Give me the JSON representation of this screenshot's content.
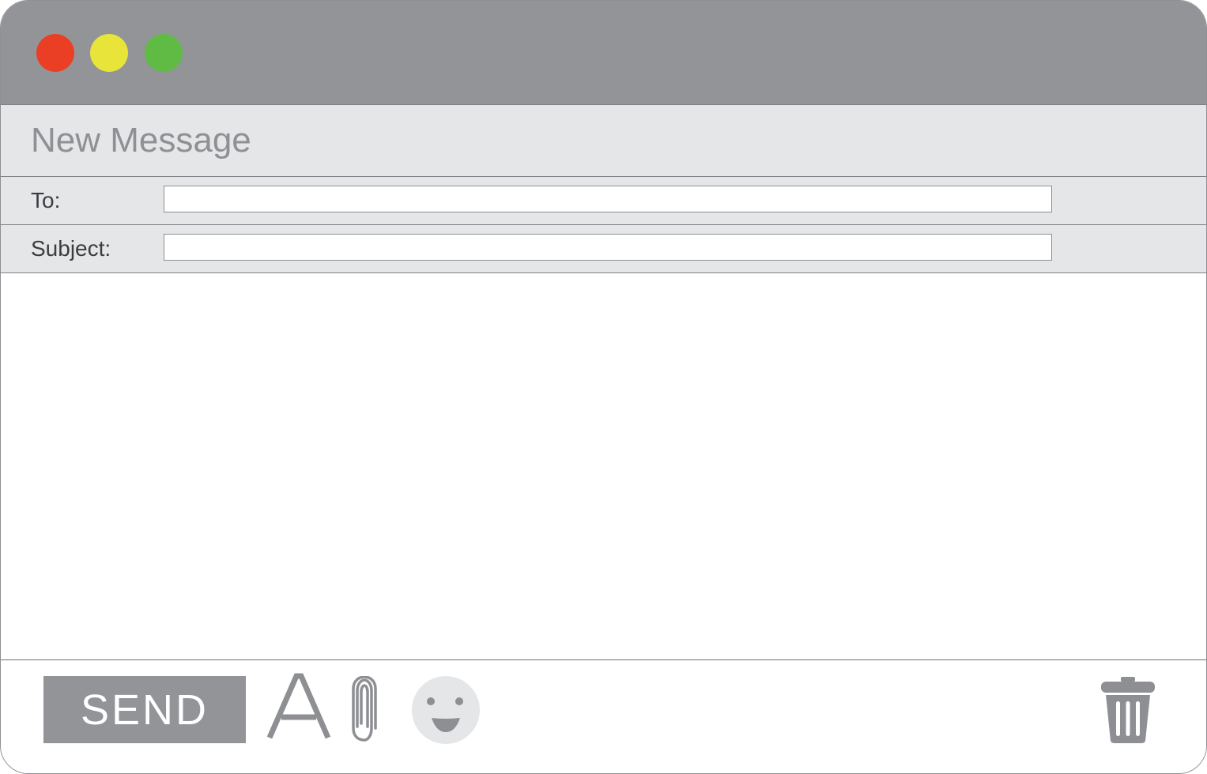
{
  "window": {
    "controls": [
      {
        "name": "close",
        "color": "#ea3f24"
      },
      {
        "name": "minimize",
        "color": "#e8e43a"
      },
      {
        "name": "zoom",
        "color": "#5fbb43"
      }
    ]
  },
  "compose": {
    "title": "New Message",
    "to": {
      "label": "To:",
      "value": "",
      "placeholder": ""
    },
    "subject": {
      "label": "Subject:",
      "value": "",
      "placeholder": ""
    },
    "body": {
      "value": "",
      "placeholder": ""
    }
  },
  "toolbar": {
    "send_label": "SEND",
    "font_icon": "font-format-icon",
    "attach_icon": "paperclip-icon",
    "emoji_icon": "smiley-icon",
    "trash_icon": "trash-icon"
  },
  "colors": {
    "titlebar": "#939498",
    "header_bg": "#e5e6e8",
    "accent_gray": "#939498"
  }
}
